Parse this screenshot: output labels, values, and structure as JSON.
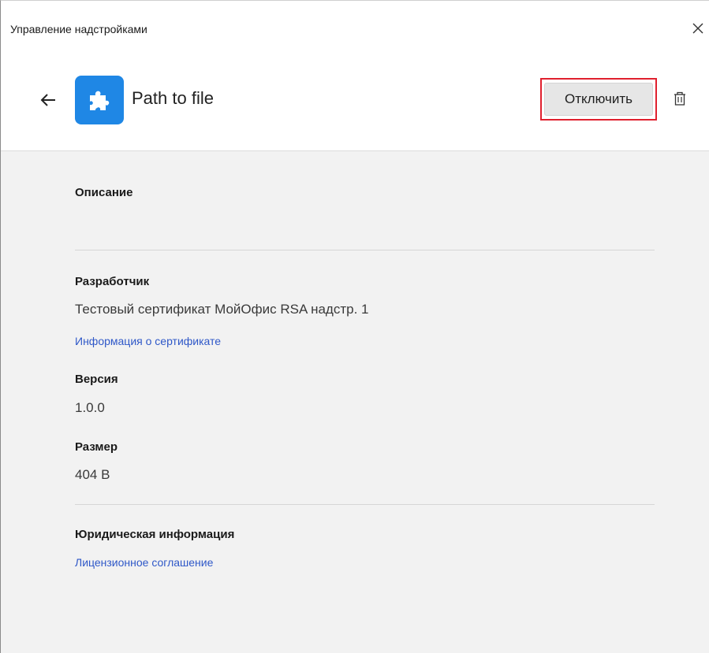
{
  "window": {
    "title": "Управление надстройками",
    "close_glyph": "✕"
  },
  "header": {
    "back_icon": "arrow-left-icon",
    "addon_icon": "puzzle-piece-icon",
    "addon_name": "Path to file",
    "disable_label": "Отключить",
    "delete_icon": "trash-icon"
  },
  "details": {
    "description_label": "Описание",
    "developer_label": "Разработчик",
    "developer_value": "Тестовый сертификат МойОфис RSA надстр. 1",
    "certificate_link": "Информация о сертификате",
    "version_label": "Версия",
    "version_value": "1.0.0",
    "size_label": "Размер",
    "size_value": "404 B",
    "legal_label": "Юридическая информация",
    "license_link": "Лицензионное соглашение"
  },
  "colors": {
    "accent": "#1f87e5",
    "link": "#2f58c8",
    "highlight_frame": "#e0202e",
    "content_bg": "#f2f2f2"
  }
}
